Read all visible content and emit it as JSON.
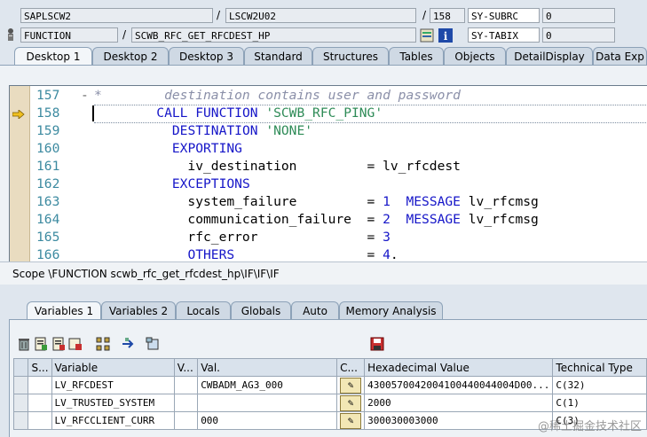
{
  "header": {
    "program": "SAPLSCW2",
    "sep1": "/",
    "include": "LSCW2U02",
    "sep2": "/",
    "line_no": "158",
    "sysubrc_label": "SY-SUBRC",
    "sysubrc_value": "0",
    "type": "FUNCTION",
    "sep3": "/",
    "function_name": "SCWB_RFC_GET_RFCDEST_HP",
    "sytabix_label": "SY-TABIX",
    "sytabix_value": "0"
  },
  "desktop_tabs": [
    "Desktop 1",
    "Desktop 2",
    "Desktop 3",
    "Standard",
    "Structures",
    "Tables",
    "Objects",
    "DetailDisplay",
    "Data Exp"
  ],
  "code": {
    "lines": [
      {
        "num": "157",
        "marker": "-",
        "parts": [
          {
            "t": "*        destination contains user and password",
            "c": "cmt"
          }
        ]
      },
      {
        "num": "158",
        "marker": "",
        "parts": [
          {
            "t": "        ",
            "c": ""
          },
          {
            "t": "CALL FUNCTION",
            "c": "kw"
          },
          {
            "t": " ",
            "c": ""
          },
          {
            "t": "'SCWB_RFC_PING'",
            "c": "str"
          }
        ]
      },
      {
        "num": "159",
        "marker": "",
        "parts": [
          {
            "t": "          ",
            "c": ""
          },
          {
            "t": "DESTINATION",
            "c": "kw"
          },
          {
            "t": " ",
            "c": ""
          },
          {
            "t": "'NONE'",
            "c": "str"
          }
        ]
      },
      {
        "num": "160",
        "marker": "",
        "parts": [
          {
            "t": "          ",
            "c": ""
          },
          {
            "t": "EXPORTING",
            "c": "kw"
          }
        ]
      },
      {
        "num": "161",
        "marker": "",
        "parts": [
          {
            "t": "            iv_destination         = lv_rfcdest",
            "c": ""
          }
        ]
      },
      {
        "num": "162",
        "marker": "",
        "parts": [
          {
            "t": "          ",
            "c": ""
          },
          {
            "t": "EXCEPTIONS",
            "c": "kw"
          }
        ]
      },
      {
        "num": "163",
        "marker": "",
        "parts": [
          {
            "t": "            system_failure         = ",
            "c": ""
          },
          {
            "t": "1",
            "c": "kw"
          },
          {
            "t": "  ",
            "c": ""
          },
          {
            "t": "MESSAGE",
            "c": "kw"
          },
          {
            "t": " lv_rfcmsg",
            "c": ""
          }
        ]
      },
      {
        "num": "164",
        "marker": "",
        "parts": [
          {
            "t": "            communication_failure  = ",
            "c": ""
          },
          {
            "t": "2",
            "c": "kw"
          },
          {
            "t": "  ",
            "c": ""
          },
          {
            "t": "MESSAGE",
            "c": "kw"
          },
          {
            "t": " lv_rfcmsg",
            "c": ""
          }
        ]
      },
      {
        "num": "165",
        "marker": "",
        "parts": [
          {
            "t": "            rfc_error              = ",
            "c": ""
          },
          {
            "t": "3",
            "c": "kw"
          }
        ]
      },
      {
        "num": "166",
        "marker": "",
        "parts": [
          {
            "t": "            ",
            "c": ""
          },
          {
            "t": "OTHERS",
            "c": "kw"
          },
          {
            "t": "                 = ",
            "c": ""
          },
          {
            "t": "4",
            "c": "kw"
          },
          {
            "t": ".",
            "c": ""
          }
        ]
      }
    ],
    "current_line": "158"
  },
  "scope_text": "Scope \\FUNCTION scwb_rfc_get_rfcdest_hp\\IF\\IF\\IF",
  "var_tabs": [
    "Variables 1",
    "Variables 2",
    "Locals",
    "Globals",
    "Auto",
    "Memory Analysis"
  ],
  "grid": {
    "headers": [
      "S...",
      "Variable",
      "V...",
      "Val.",
      "C...",
      "Hexadecimal Value",
      "Technical Type"
    ],
    "rows": [
      {
        "variable": "LV_RFCDEST",
        "value": "CWBADM_AG3_000",
        "hex": "4300570042004100440044004D00...",
        "type": "C(32)"
      },
      {
        "variable": "LV_TRUSTED_SYSTEM",
        "value": "",
        "hex": "2000",
        "type": "C(1)"
      },
      {
        "variable": "LV_RFCCLIENT_CURR",
        "value": "000",
        "hex": "300030003000",
        "type": "C(3)"
      }
    ]
  },
  "watermark": "@稀土掘金技术社区"
}
